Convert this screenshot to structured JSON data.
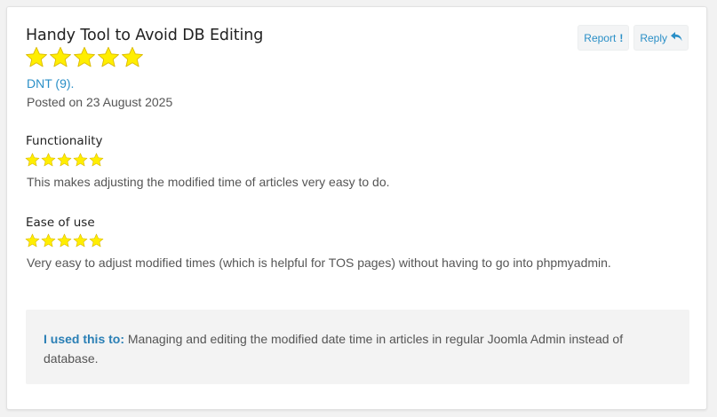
{
  "review": {
    "title": "Handy Tool to Avoid DB Editing",
    "overall_rating": 5,
    "rating_max": 5,
    "author": "DNT (9).",
    "posted": "Posted on 23 August 2025"
  },
  "actions": {
    "report_label": "Report",
    "report_icon": "!",
    "reply_label": "Reply",
    "reply_icon": "reply-icon"
  },
  "sections": [
    {
      "heading": "Functionality",
      "rating": 5,
      "text": "This makes adjusting the modified time of articles very easy to do."
    },
    {
      "heading": "Ease of use",
      "rating": 5,
      "text": "Very easy to adjust modified times (which is helpful for TOS pages) without having to go into phpmyadmin."
    }
  ],
  "usage": {
    "label": "I used this to:",
    "text": "Managing and editing the modified date time in articles in regular Joomla Admin instead of database."
  },
  "colors": {
    "star_fill": "#ffee00",
    "star_stroke": "#d9b800",
    "link": "#2a8fc7",
    "usage_label": "#2a7fb5"
  }
}
